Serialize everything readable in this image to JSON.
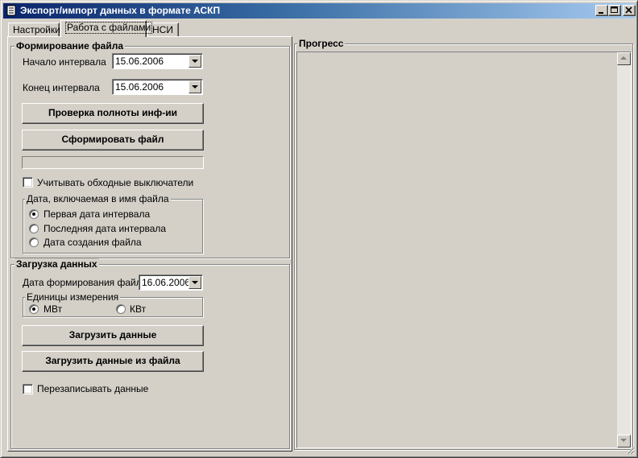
{
  "window": {
    "title": "Экспорт/импорт данных в формате АСКП"
  },
  "tabs": [
    {
      "label": "Настройки"
    },
    {
      "label": "Работа с файлами"
    },
    {
      "label": "НСИ"
    }
  ],
  "file_forming": {
    "title": "Формирование файла",
    "start_label": "Начало интервала",
    "start_value": "15.06.2006",
    "end_label": "Конец интервала",
    "end_value": "15.06.2006",
    "check_button": "Проверка полноты инф-ии",
    "form_button": "Сформировать файл",
    "bypass_label": "Учитывать обходные выключатели",
    "filename_date": {
      "title": "Дата, включаемая в имя файла",
      "options": [
        "Первая дата интервала",
        "Последняя дата интервала",
        "Дата создания файла"
      ],
      "selected": "Первая дата интервала"
    }
  },
  "data_load": {
    "title": "Загрузка данных",
    "date_label": "Дата формирования файла",
    "date_value": "16.06.2006",
    "units": {
      "title": "Единицы измерения",
      "options": [
        "МВт",
        "КВт"
      ],
      "selected": "МВт"
    },
    "load_button": "Загрузить данные",
    "load_file_button": "Загрузить данные из файла",
    "overwrite_label": "Перезаписывать данные"
  },
  "progress": {
    "title": "Прогресс"
  }
}
